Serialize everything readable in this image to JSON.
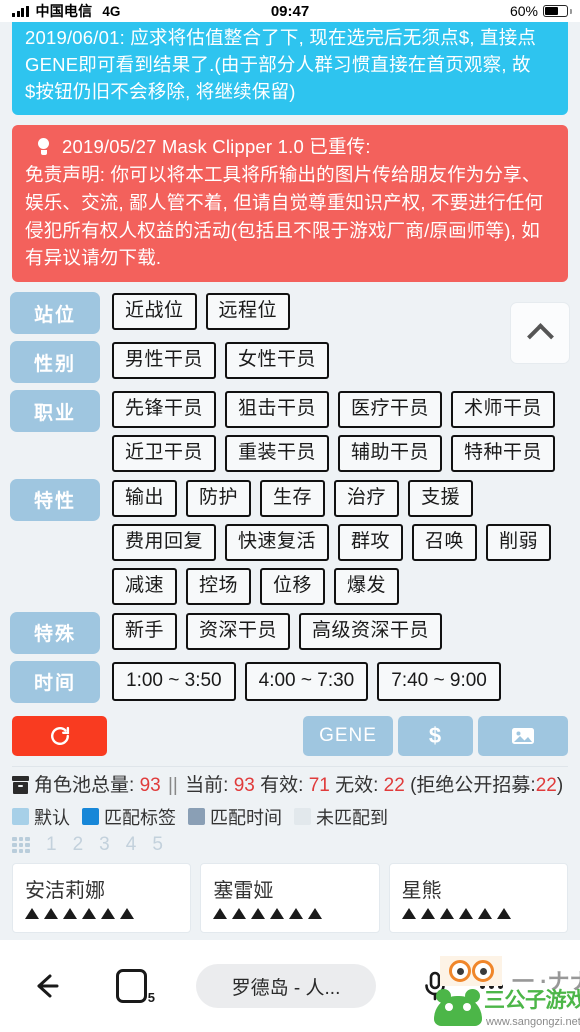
{
  "statusbar": {
    "carrier": "中国电信",
    "network": "4G",
    "time": "09:47",
    "battery_label": "60%",
    "battery_percent": 60
  },
  "alerts": [
    {
      "type": "info",
      "color": "#2ec4ef",
      "text": "2019/06/01: 应求将估值整合了下, 现在选完后无须点$, 直接点GENE即可看到结果了.(由于部分人群习惯直接在首页观察, 故$按钮仍旧不会移除, 将继续保留)"
    },
    {
      "type": "danger",
      "color": "#f3615c",
      "icon": "lightbulb-icon",
      "heading": "2019/05/27 Mask Clipper 1.0 已重传:",
      "text": "免责声明: 你可以将本工具将所输出的图片传给朋友作为分享、娱乐、交流, 鄙人管不着, 但请自觉尊重知识产权, 不要进行任何侵犯所有权人权益的活动(包括且不限于游戏厂商/原画师等), 如有异议请勿下载."
    }
  ],
  "filters": [
    {
      "label": "站位",
      "options": [
        "近战位",
        "远程位"
      ]
    },
    {
      "label": "性别",
      "options": [
        "男性干员",
        "女性干员"
      ]
    },
    {
      "label": "职业",
      "options": [
        "先锋干员",
        "狙击干员",
        "医疗干员",
        "术师干员",
        "近卫干员",
        "重装干员",
        "辅助干员",
        "特种干员"
      ]
    },
    {
      "label": "特性",
      "options": [
        "输出",
        "防护",
        "生存",
        "治疗",
        "支援",
        "费用回复",
        "快速复活",
        "群攻",
        "召唤",
        "削弱",
        "减速",
        "控场",
        "位移",
        "爆发"
      ]
    },
    {
      "label": "特殊",
      "options": [
        "新手",
        "资深干员",
        "高级资深干员"
      ]
    },
    {
      "label": "时间",
      "options": [
        "1:00 ~ 3:50",
        "4:00 ~ 7:30",
        "7:40 ~ 9:00"
      ]
    }
  ],
  "scroll_top": {
    "name": "scroll-to-top-button",
    "icon": "chevron-up-icon"
  },
  "actions": {
    "reset_label": "",
    "reset_icon": "refresh-icon",
    "reset_color": "#f93b20",
    "gene_label": "GENE",
    "dollar_label": "$",
    "image_icon": "image-icon",
    "blue_color": "#9fc6e0"
  },
  "stats": {
    "icon": "archive-icon",
    "pool_label": "角色池总量:",
    "pool_total": "93",
    "separator": "||",
    "current_label": "当前:",
    "current": "93",
    "valid_label": "有效:",
    "valid": "71",
    "invalid_label": "无效:",
    "invalid": "22",
    "note_open": "(拒绝公开招募:",
    "note_value": "22",
    "note_close": ")",
    "number_color": "#e03b3b"
  },
  "legend": [
    {
      "label": "默认",
      "color": "#a7d0e8"
    },
    {
      "label": "匹配标签",
      "color": "#1787d8"
    },
    {
      "label": "匹配时间",
      "color": "#8a9fb5"
    },
    {
      "label": "未匹配到",
      "color": "#e2e8ec"
    }
  ],
  "pagination": {
    "grid_icon": "grid-icon",
    "pages": [
      "1",
      "2",
      "3",
      "4",
      "5"
    ]
  },
  "cards": [
    {
      "name": "安洁莉娜",
      "stars": 6
    },
    {
      "name": "塞雷娅",
      "stars": 6
    },
    {
      "name": "星熊",
      "stars": 6
    }
  ],
  "navbar": {
    "back_icon": "back-arrow-icon",
    "tabs_icon": "tabs-icon",
    "tabs_count": "5",
    "url_text": "罗德岛 - 人...",
    "mic_icon": "microphone-icon",
    "more_icon": "more-dots-icon"
  },
  "watermark": {
    "brand": "三公子游戏网",
    "url": "www.sangongzi.net"
  }
}
